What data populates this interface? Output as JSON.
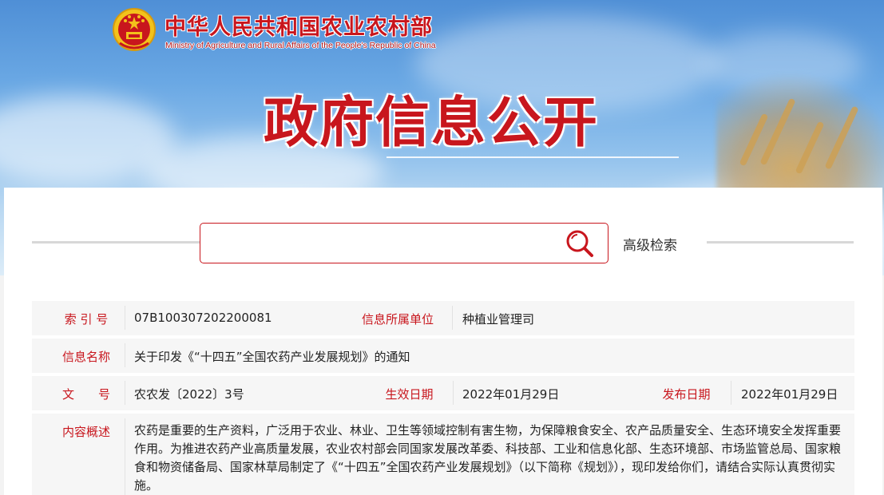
{
  "header": {
    "site_title_cn": "中华人民共和国农业农村部",
    "site_title_en": "Ministry of Agriculture and Rural Affairs of the People's Republic of China",
    "section_title": "政府信息公开"
  },
  "search": {
    "placeholder": "",
    "value": "",
    "advanced_label": "高级检索"
  },
  "info": {
    "index_label": "索 引 号",
    "index_value": "07B100307202200081",
    "unit_label": "信息所属单位",
    "unit_value": "种植业管理司",
    "name_label": "信息名称",
    "name_value": "关于印发《“十四五”全国农药产业发展规划》的通知",
    "doc_label": "文　　号",
    "doc_value": "农农发〔2022〕3号",
    "effective_label": "生效日期",
    "effective_value": "2022年01月29日",
    "publish_label": "发布日期",
    "publish_value": "2022年01月29日",
    "summary_label": "内容概述",
    "summary_value": "农药是重要的生产资料，广泛用于农业、林业、卫生等领域控制有害生物，为保障粮食安全、农产品质量安全、生态环境安全发挥重要作用。为推进农药产业高质量发展，农业农村部会同国家发展改革委、科技部、工业和信息化部、生态环境部、市场监管总局、国家粮食和物资储备局、国家林草局制定了《“十四五”全国农药产业发展规划》（以下简称《规划》），现印发给你们，请结合实际认真贯彻实施。"
  },
  "colors": {
    "accent": "#c8161d",
    "banner_sky": "#6aa8e4",
    "label_text": "#c8161d",
    "value_text": "#222222"
  }
}
